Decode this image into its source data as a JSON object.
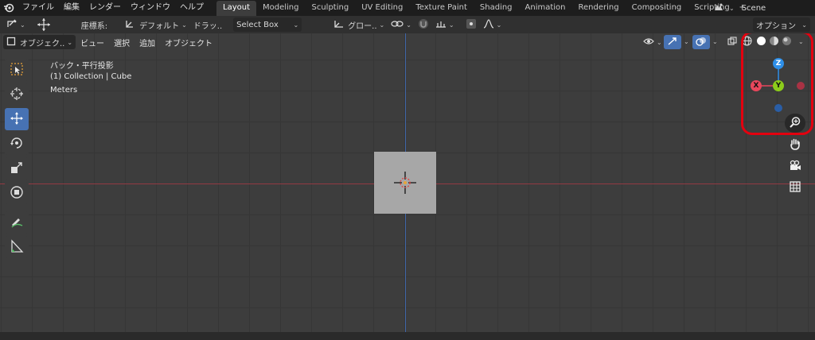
{
  "menubar": {
    "items": [
      "ファイル",
      "編集",
      "レンダー",
      "ウィンドウ",
      "ヘルプ"
    ]
  },
  "workspace_tabs": [
    "Layout",
    "Modeling",
    "Sculpting",
    "UV Editing",
    "Texture Paint",
    "Shading",
    "Animation",
    "Rendering",
    "Compositing",
    "Scripting"
  ],
  "active_tab": "Layout",
  "scene": {
    "name": "Scene"
  },
  "header": {
    "orientation_label": "座標系:",
    "orientation_value": "デフォルト",
    "drag_label": "ドラッ..",
    "select_mode": "Select Box",
    "pivot_label": "グロー..",
    "options_label": "オプション"
  },
  "viewport_header": {
    "mode": "オブジェク..",
    "view": "ビュー",
    "select": "選択",
    "add": "追加",
    "object": "オブジェクト"
  },
  "overlay_info": {
    "view_name": "バック・平行投影",
    "collection": "(1) Collection | Cube",
    "units": "Meters"
  },
  "gizmo": {
    "z_label": "Z",
    "y_label": "Y",
    "x_label": "X"
  },
  "colors": {
    "active_blue": "#4772b3",
    "x_axis": "#e8475c",
    "y_axis": "#8ccc1b",
    "z_axis": "#2e8fe8",
    "highlight": "#e3000f"
  }
}
